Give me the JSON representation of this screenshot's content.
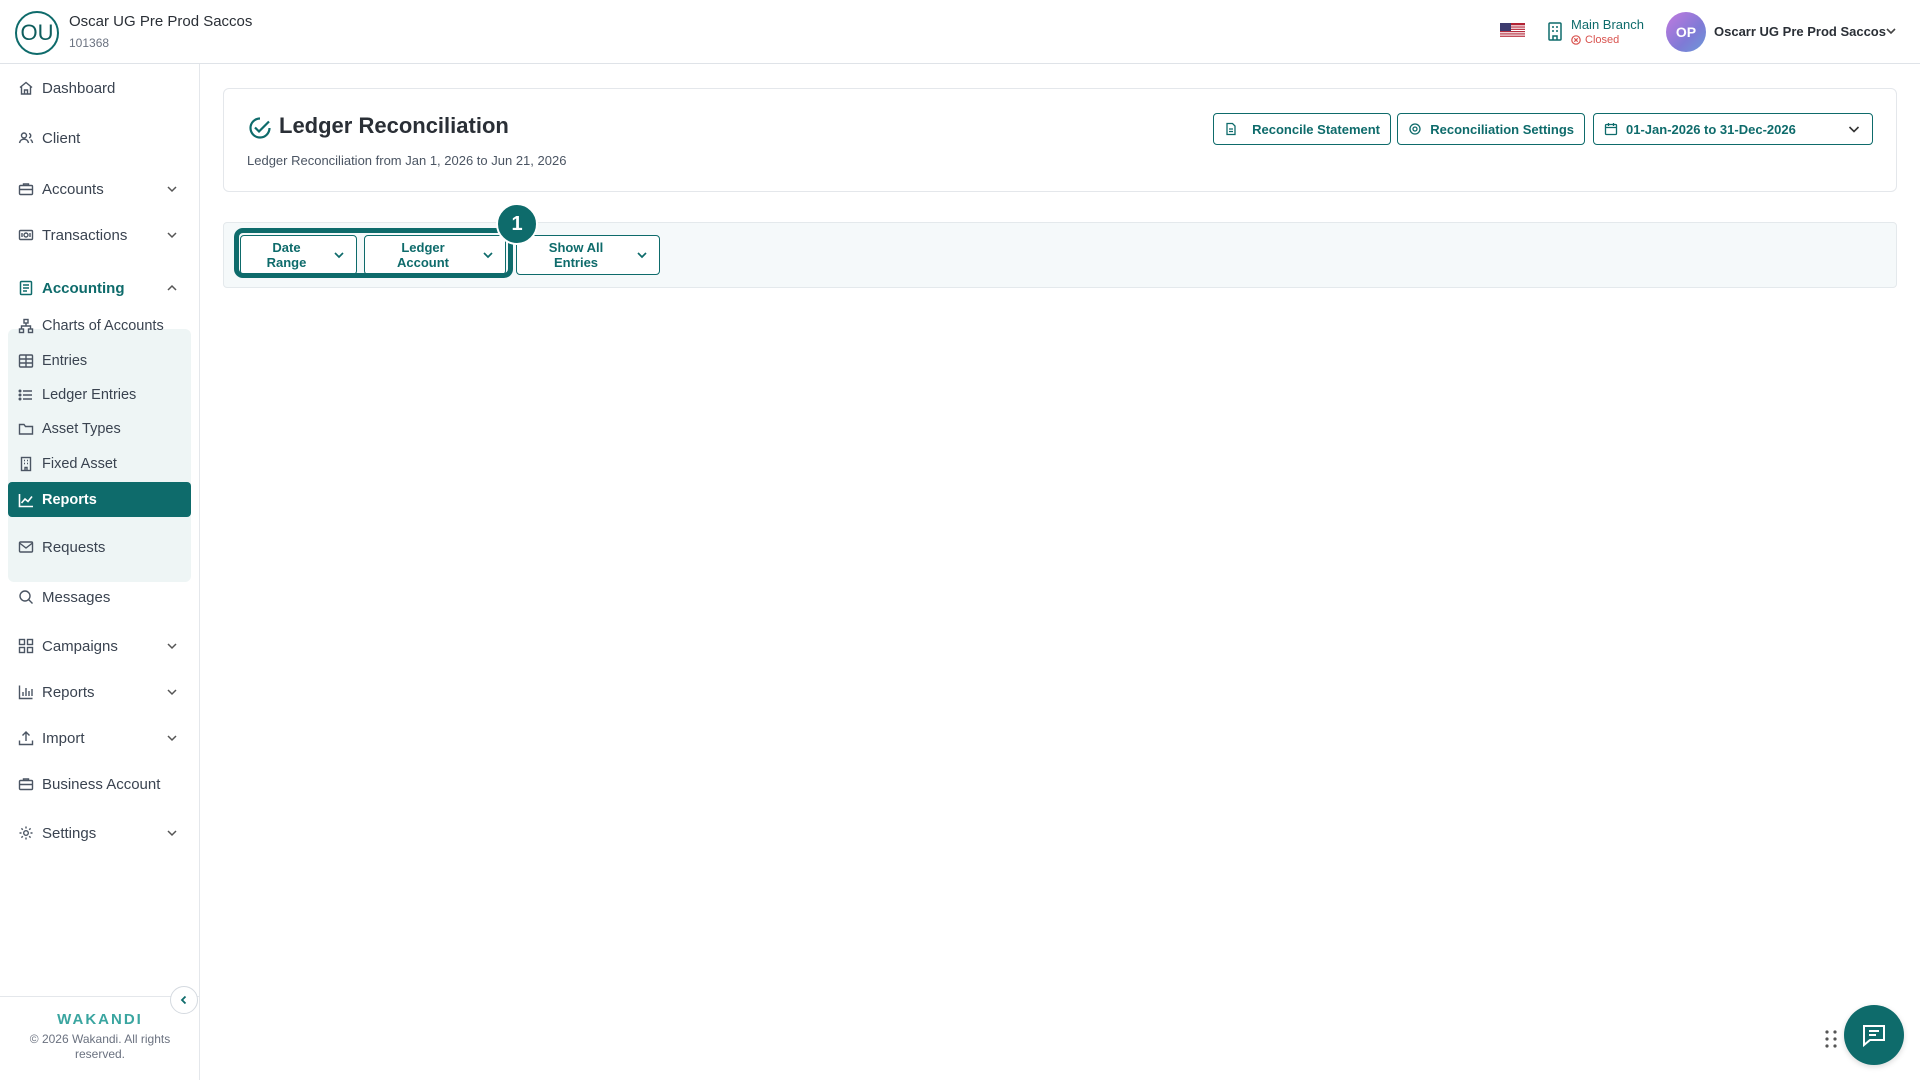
{
  "header": {
    "org_initials": "OU",
    "org_name": "Oscar UG Pre Prod Saccos",
    "org_id": "101368",
    "branch_name": "Main Branch",
    "branch_status": "Closed",
    "user_initials": "OP",
    "user_name": "Oscarr UG Pre Prod Saccos"
  },
  "sidebar": {
    "items": [
      {
        "label": "Dashboard",
        "icon": "home-icon"
      },
      {
        "label": "Client",
        "icon": "users-icon"
      },
      {
        "label": "Accounts",
        "icon": "briefcase-icon",
        "expandable": true
      },
      {
        "label": "Transactions",
        "icon": "money-icon",
        "expandable": true
      },
      {
        "label": "Accounting",
        "icon": "ledger-icon",
        "expanded": true
      },
      {
        "label": "Charts of Accounts",
        "icon": "sitemap-icon"
      },
      {
        "label": "Entries",
        "icon": "table-icon"
      },
      {
        "label": "Ledger Entries",
        "icon": "list-icon"
      },
      {
        "label": "Asset Types",
        "icon": "folder-icon"
      },
      {
        "label": "Fixed Asset",
        "icon": "building-icon"
      },
      {
        "label": "Reports",
        "icon": "chart-line-icon",
        "active": true
      },
      {
        "label": "Requests",
        "icon": "mail-icon"
      },
      {
        "label": "Messages",
        "icon": "chat-search-icon"
      },
      {
        "label": "Campaigns",
        "icon": "grid-icon",
        "expandable": true
      },
      {
        "label": "Reports",
        "icon": "bar-chart-icon",
        "expandable": true
      },
      {
        "label": "Import",
        "icon": "upload-icon",
        "expandable": true
      },
      {
        "label": "Business Account",
        "icon": "briefcase-icon"
      },
      {
        "label": "Settings",
        "icon": "gear-icon",
        "expandable": true
      }
    ],
    "brand": "WAKANDI",
    "copyright": "© 2026 Wakandi. All rights reserved."
  },
  "page": {
    "title": "Ledger Reconciliation",
    "subtitle": "Ledger Reconciliation from Jan 1, 2026 to Jun 21, 2026",
    "reconcile_label": "Reconcile Statement",
    "settings_label": "Reconciliation Settings",
    "date_range_value": "01-Jan-2026 to 31-Dec-2026"
  },
  "filters": {
    "date_range": "Date Range",
    "ledger_account": "Ledger Account",
    "show_entries": "Show All Entries",
    "step_badge": "1"
  },
  "colors": {
    "accent": "#0e6b6b",
    "status_closed": "#d9534f"
  }
}
